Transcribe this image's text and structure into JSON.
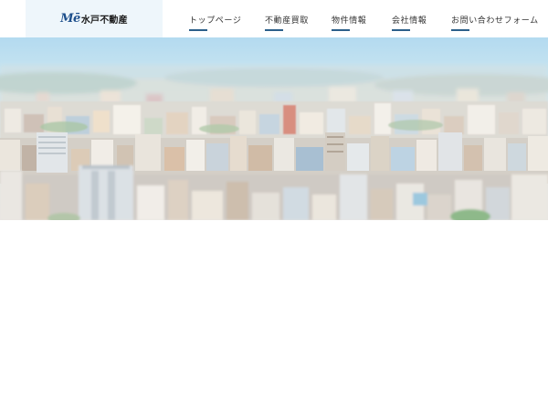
{
  "header": {
    "logo_mark": "Mē",
    "logo_text": "水戸不動産"
  },
  "nav": {
    "items": [
      {
        "label": "トップページ"
      },
      {
        "label": "不動産買取"
      },
      {
        "label": "物件情報"
      },
      {
        "label": "会社情報"
      },
      {
        "label": "お問い合わせフォーム"
      }
    ]
  },
  "colors": {
    "accent": "#2c5f8a",
    "logo_bg": "#eef6fb",
    "logo_mark": "#1d4f8c"
  }
}
